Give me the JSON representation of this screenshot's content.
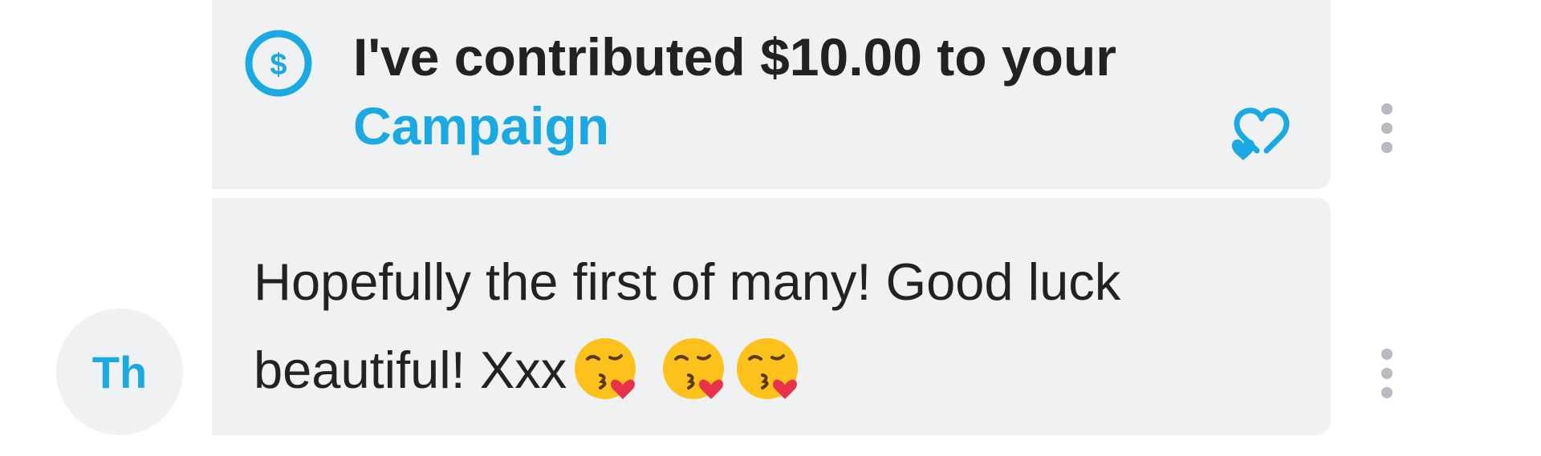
{
  "contribution": {
    "text": "I've contributed $10.00 to your",
    "link": "Campaign"
  },
  "message": {
    "text": "Hopefully the first of many! Good luck",
    "text_line2": "beautiful! Xxx"
  },
  "sender": {
    "initials": "Th"
  },
  "icons": {
    "dollar": "dollar-circle-icon",
    "like": "double-heart-icon",
    "more": "vertical-ellipsis-icon",
    "emoji": "face-blowing-kiss-emoji"
  },
  "colors": {
    "accent": "#1aa9e2",
    "bubble": "#f0f1f3",
    "text": "#222222",
    "muted": "#b8bcc2"
  }
}
